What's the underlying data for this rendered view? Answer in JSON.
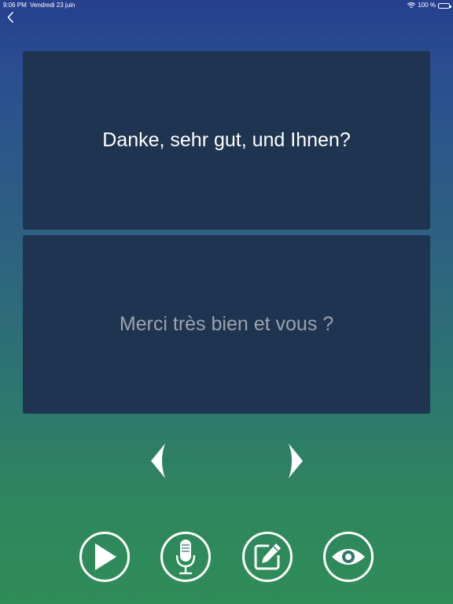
{
  "status_bar": {
    "time": "9:06 PM",
    "date": "Vendredi 23 juin",
    "battery": "100 %",
    "icons": [
      "wifi-icon",
      "battery-icon"
    ]
  },
  "navigation": {
    "back_icon": "chevron-left-icon"
  },
  "cards": {
    "source_text": "Danke, sehr gut, und Ihnen?",
    "translation_text": "Merci très bien et vous ?"
  },
  "pager": {
    "previous_icon": "arrow-left-icon",
    "next_icon": "arrow-right-icon"
  },
  "actions": [
    {
      "name": "play",
      "icon": "play-icon"
    },
    {
      "name": "microphone",
      "icon": "microphone-icon"
    },
    {
      "name": "edit",
      "icon": "edit-icon"
    },
    {
      "name": "reveal",
      "icon": "eye-icon"
    }
  ],
  "colors": {
    "card_background": "#1f3450",
    "translation_text": "#9aa3ad",
    "gradient_top": "#263f8f",
    "gradient_bottom": "#2f8d57"
  }
}
